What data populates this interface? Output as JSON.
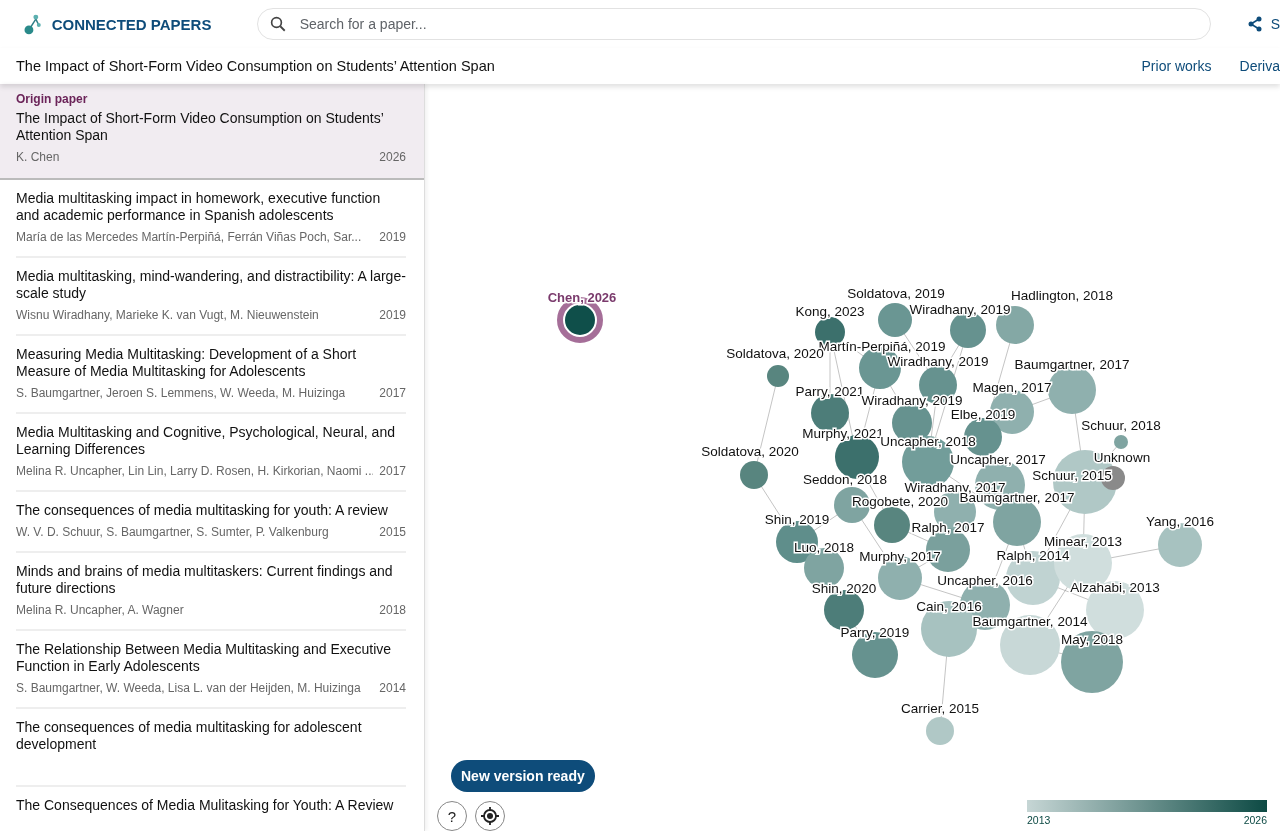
{
  "header": {
    "brand": "CONNECTED PAPERS",
    "search": {
      "placeholder": "Search for a paper..."
    },
    "share_label": "S"
  },
  "title_bar": {
    "title": "The Impact of Short-Form Video Consumption on Students’ Attention Span",
    "links": [
      "Prior works",
      "Deriva"
    ]
  },
  "origin": {
    "label": "Origin paper",
    "title": "The Impact of Short-Form Video Consumption on Students’ Attention Span",
    "authors": "K. Chen",
    "year": "2026",
    "selected": true
  },
  "papers": [
    {
      "title": "Media multitasking impact in homework, executive function and academic performance in Spanish adolescents",
      "authors": "María de las Mercedes Martín‐Perpiñá, Ferrán Viñas Poch, Sar...",
      "year": "2019"
    },
    {
      "title": "Media multitasking, mind-wandering, and distractibility: A large-scale study",
      "authors": "Wisnu Wiradhany, Marieke K. van Vugt, M. Nieuwenstein",
      "year": "2019"
    },
    {
      "title": "Measuring Media Multitasking: Development of a Short Measure of Media Multitasking for Adolescents",
      "authors": "S. Baumgartner, Jeroen S. Lemmens, W. Weeda, M. Huizinga",
      "year": "2017"
    },
    {
      "title": "Media Multitasking and Cognitive, Psychological, Neural, and Learning Differences",
      "authors": "Melina R. Uncapher, Lin Lin, Larry D. Rosen, H. Kirkorian, Naomi ...",
      "year": "2017"
    },
    {
      "title": "The consequences of media multitasking for youth: A review",
      "authors": "W. V. D. Schuur, S. Baumgartner, S. Sumter, P. Valkenburg",
      "year": "2015"
    },
    {
      "title": "Minds and brains of media multitaskers: Current findings and future directions",
      "authors": "Melina R. Uncapher, A. Wagner",
      "year": "2018"
    },
    {
      "title": "The Relationship Between Media Multitasking and Executive Function in Early Adolescents",
      "authors": "S. Baumgartner, W. Weeda, Lisa L. van der Heijden, M. Huizinga",
      "year": "2014"
    },
    {
      "title": "The consequences of media multitasking for adolescent development"
    },
    {
      "title": "The Consequences of Media Mulitasking for Youth: A Review"
    }
  ],
  "graph": {
    "nodes": [
      {
        "label": "Chen, 2026",
        "kind": "origin",
        "color": "#0f4f4a"
      },
      {
        "label": "Kong, 2023",
        "kind": "paper",
        "color": "#3c706c"
      },
      {
        "label": "Soldatova, 2019",
        "kind": "paper",
        "color": "#6a9693"
      },
      {
        "label": "Wiradhany, 2019",
        "kind": "paper",
        "color": "#66928f"
      },
      {
        "label": "Hadlington, 2018",
        "kind": "paper",
        "color": "#84a8a5"
      },
      {
        "label": "Martín‐Perpiñá, 2019",
        "kind": "paper",
        "color": "#6a9693"
      },
      {
        "label": "Soldatova, 2020",
        "kind": "paper",
        "color": "#58857f"
      },
      {
        "label": "Wiradhany, 2019",
        "kind": "paper",
        "color": "#66928f"
      },
      {
        "label": "Baumgartner, 2017",
        "kind": "paper",
        "color": "#8fb0ae"
      },
      {
        "label": "Parry, 2021",
        "kind": "paper",
        "color": "#4d7d79"
      },
      {
        "label": "Wiradhany, 2019",
        "kind": "paper",
        "color": "#66928f"
      },
      {
        "label": "Magen, 2017",
        "kind": "paper",
        "color": "#8fb0ae"
      },
      {
        "label": "Elbe, 2019",
        "kind": "paper",
        "color": "#66928f"
      },
      {
        "label": "Schuur, 2018",
        "kind": "paper",
        "color": "#7fa4a1"
      },
      {
        "label": "Murphy, 2021",
        "kind": "paper",
        "color": "#3c706c"
      },
      {
        "label": "Uncapher, 2018",
        "kind": "paper",
        "color": "#729d9a"
      },
      {
        "label": "Soldatova, 2020",
        "kind": "paper",
        "color": "#58857f"
      },
      {
        "label": "Uncapher, 2017",
        "kind": "paper",
        "color": "#8fb0ae"
      },
      {
        "label": "Schuur, 2015",
        "kind": "paper",
        "color": "#b0c8c6"
      },
      {
        "label": "Unknown",
        "kind": "unknown",
        "color": "#8a8a8a"
      },
      {
        "label": "Seddon, 2018",
        "kind": "paper",
        "color": "#7fa4a1"
      },
      {
        "label": "Wiradhany, 2017",
        "kind": "paper",
        "color": "#8fb0ae"
      },
      {
        "label": "Rogobete, 2020",
        "kind": "paper",
        "color": "#58857f"
      },
      {
        "label": "Baumgartner, 2017",
        "kind": "paper",
        "color": "#7fa4a1"
      },
      {
        "label": "Shin, 2019",
        "kind": "paper",
        "color": "#5f8e8b"
      },
      {
        "label": "Ralph, 2017",
        "kind": "paper",
        "color": "#7aa09d"
      },
      {
        "label": "Luo, 2018",
        "kind": "paper",
        "color": "#7fa4a1"
      },
      {
        "label": "Murphy, 2017",
        "kind": "paper",
        "color": "#8fb0ae"
      },
      {
        "label": "Ralph, 2014",
        "kind": "paper",
        "color": "#c0d3d2"
      },
      {
        "label": "Minear, 2013",
        "kind": "paper",
        "color": "#d0dedd"
      },
      {
        "label": "Yang, 2016",
        "kind": "paper",
        "color": "#a7c2c0"
      },
      {
        "label": "Uncapher, 2016",
        "kind": "paper",
        "color": "#8fb0ae"
      },
      {
        "label": "Shin, 2020",
        "kind": "paper",
        "color": "#4d7d79"
      },
      {
        "label": "Alzahabi, 2013",
        "kind": "paper",
        "color": "#d0dedd"
      },
      {
        "label": "Cain, 2016",
        "kind": "paper",
        "color": "#a7c2c0"
      },
      {
        "label": "Baumgartner, 2014",
        "kind": "paper",
        "color": "#c8d8d7"
      },
      {
        "label": "Parry, 2019",
        "kind": "paper",
        "color": "#66928f"
      },
      {
        "label": "May, 2018",
        "kind": "paper",
        "color": "#7fa4a1"
      },
      {
        "label": "Carrier, 2015",
        "kind": "paper",
        "color": "#b0c8c6"
      }
    ],
    "update_button": "New version ready",
    "help_button": "?",
    "legend": {
      "min_label": "2013",
      "max_label": "2026"
    }
  }
}
